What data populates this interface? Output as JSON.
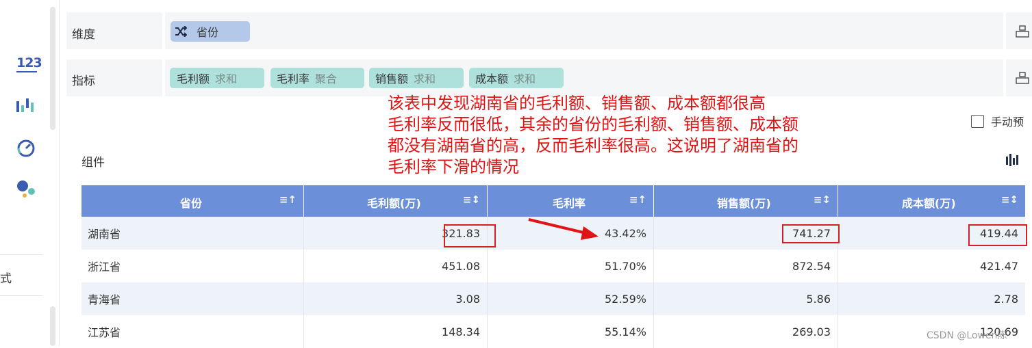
{
  "left_rail": {
    "items": [
      {
        "icon": "number-123-icon",
        "label": "123"
      },
      {
        "icon": "bar-chart-icon"
      },
      {
        "icon": "gauge-icon"
      },
      {
        "icon": "dots-cluster-icon"
      }
    ],
    "truncated_text": "式"
  },
  "shelves": {
    "dimension": {
      "label": "维度",
      "pills": [
        {
          "icon": "shuffle-icon",
          "name": "省份"
        }
      ]
    },
    "measure": {
      "label": "指标",
      "pills": [
        {
          "name": "毛利额",
          "agg": "求和"
        },
        {
          "name": "毛利率",
          "agg": "聚合"
        },
        {
          "name": "销售额",
          "agg": "求和"
        },
        {
          "name": "成本额",
          "agg": "求和"
        }
      ]
    }
  },
  "annotation": {
    "lines": [
      "该表中发现湖南省的毛利额、销售额、成本额都很高",
      "毛利率反而很低，其余的省份的毛利额、销售额、成本额",
      "都没有湖南省的高，反而毛利率很高。这说明了湖南省的",
      "毛利率下滑的情况"
    ],
    "color": "#e01414"
  },
  "manual_preview": {
    "label": "手动预",
    "checked": false
  },
  "component": {
    "title": "组件"
  },
  "table": {
    "columns": [
      "省份",
      "毛利额(万)",
      "毛利率",
      "销售额(万)",
      "成本额(万)"
    ],
    "sort_icons": [
      "≡↑",
      "≡↕",
      "≡↑",
      "≡↕",
      "≡↕"
    ],
    "rows": [
      [
        "湖南省",
        "321.83",
        "43.42%",
        "741.27",
        "419.44"
      ],
      [
        "浙江省",
        "451.08",
        "51.70%",
        "872.54",
        "421.47"
      ],
      [
        "青海省",
        "3.08",
        "52.59%",
        "5.86",
        "2.78"
      ],
      [
        "江苏省",
        "148.34",
        "55.14%",
        "269.03",
        "120.69"
      ]
    ],
    "header_color": "#6b8fd8"
  },
  "watermark": "CSDN @Lowen陈"
}
